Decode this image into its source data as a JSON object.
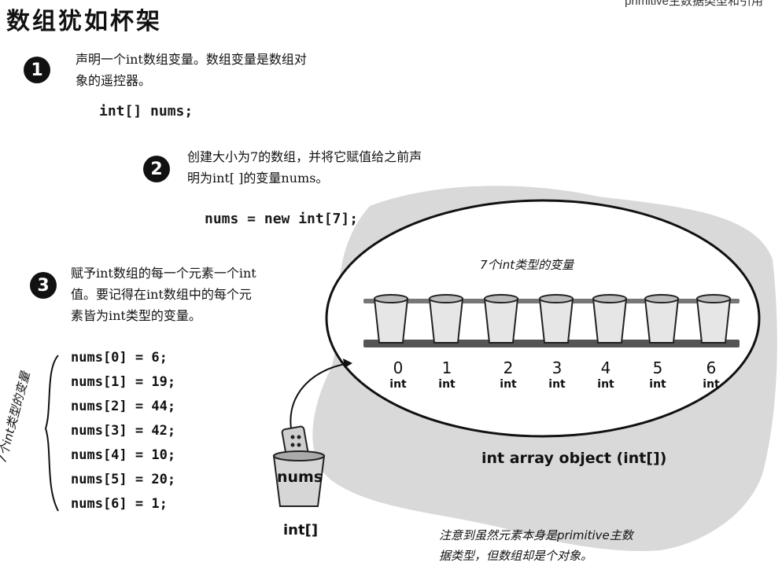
{
  "header": {
    "title": "数组犹如杯架",
    "running_head": "primitive主数据类型和引用"
  },
  "step1": {
    "number": "1",
    "text_line1": "声明一个int数组变量。数组变量是数组对",
    "text_line2": "象的遥控器。",
    "code": "int[] nums;"
  },
  "step2": {
    "number": "2",
    "text_line1": "创建大小为7的数组，并将它赋值给之前声",
    "text_line2": "明为int[ ]的变量nums。",
    "code": "nums = new int[7];"
  },
  "step3": {
    "number": "3",
    "text_line1": "赋予int数组的每一个元素一个int",
    "text_line2": "值。要记得在int数组中的每个元",
    "text_line3": "素皆为int类型的变量。",
    "code_lines": [
      "nums[0] = 6;",
      "nums[1] = 19;",
      "nums[2] = 44;",
      "nums[3] = 42;",
      "nums[4] = 10;",
      "nums[5] = 20;",
      "nums[6] = 1;"
    ],
    "side_note": "7个int类型的变量"
  },
  "array_diagram": {
    "top_label": "7个int类型的变量",
    "indices": [
      "0",
      "1",
      "2",
      "3",
      "4",
      "5",
      "6"
    ],
    "element_type": "int",
    "object_label": "int array object (int[])",
    "reference_name": "nums",
    "reference_type": "int[]",
    "bottom_note_line1": "注意到虽然元素本身是primitive主数",
    "bottom_note_line2": "据类型，但数组却是个对象。"
  }
}
